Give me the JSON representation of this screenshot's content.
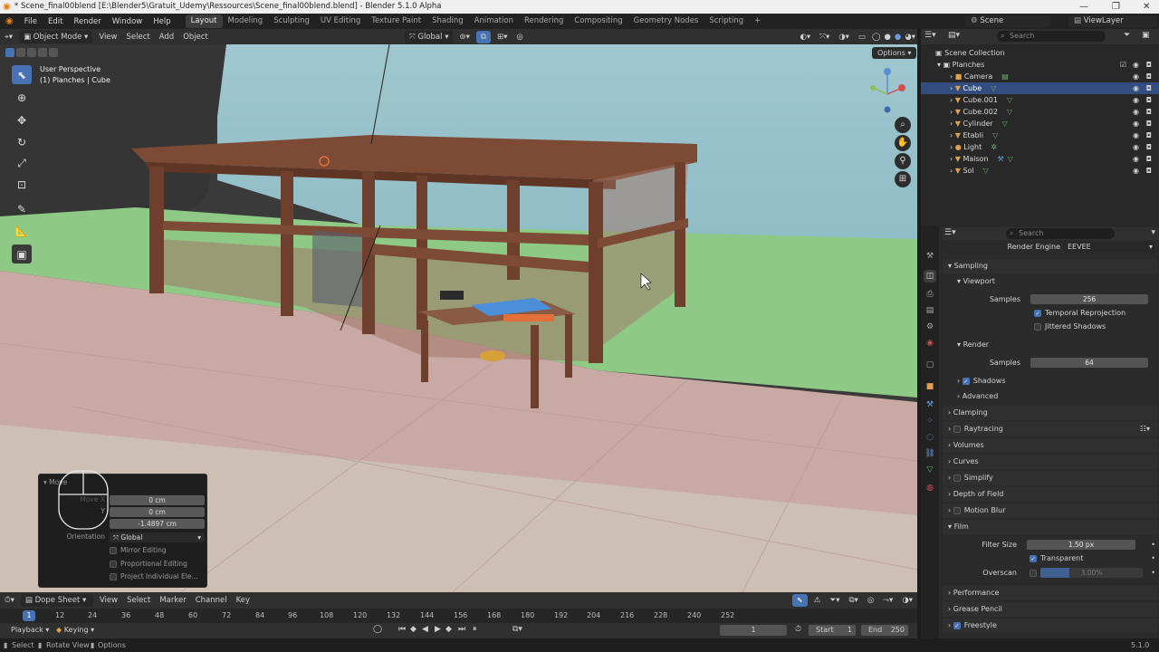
{
  "window": {
    "title": "* Scene_final00blend [E:\\Blender5\\Gratuit_Udemy\\Ressources\\Scene_final00blend.blend] - Blender 5.1.0 Alpha"
  },
  "menu": [
    "File",
    "Edit",
    "Render",
    "Window",
    "Help"
  ],
  "workspaces": [
    "Layout",
    "Modeling",
    "Sculpting",
    "UV Editing",
    "Texture Paint",
    "Shading",
    "Animation",
    "Rendering",
    "Compositing",
    "Geometry Nodes",
    "Scripting"
  ],
  "scene": {
    "name": "Scene",
    "view_layer": "ViewLayer"
  },
  "viewport": {
    "mode": "Object Mode",
    "menu": [
      "View",
      "Select",
      "Add",
      "Object"
    ],
    "transform_orientation": "Global",
    "options_label": "Options",
    "overlay_title": "User Perspective",
    "overlay_subtitle": "(1) Planches | Cube"
  },
  "move_panel": {
    "title": "Move",
    "move_x_label": "Move X",
    "y_label": "Y",
    "x_value": "0 cm",
    "y_value": "0 cm",
    "z_value": "-1.4897 cm",
    "orientation_label": "Orientation",
    "orientation_value": "Global",
    "mirror": "Mirror Editing",
    "proportional": "Proportional Editing",
    "project": "Project Individual Ele..."
  },
  "outliner": {
    "search_placeholder": "Search",
    "root": "Scene Collection",
    "collection": "Planches",
    "items": [
      "Camera",
      "Cube",
      "Cube.001",
      "Cube.002",
      "Cylinder",
      "Etabli",
      "Light",
      "Maison",
      "Sol"
    ]
  },
  "properties": {
    "search_placeholder": "Search",
    "render_engine_label": "Render Engine",
    "render_engine_value": "EEVEE",
    "sampling": "Sampling",
    "viewport": "Viewport",
    "samples_label": "Samples",
    "viewport_samples": "256",
    "temporal": "Temporal Reprojection",
    "jittered": "Jittered Shadows",
    "render": "Render",
    "render_samples": "64",
    "shadows": "Shadows",
    "advanced": "Advanced",
    "clamping": "Clamping",
    "raytracing": "Raytracing",
    "volumes": "Volumes",
    "curves": "Curves",
    "simplify": "Simplify",
    "dof": "Depth of Field",
    "motion_blur": "Motion Blur",
    "film": "Film",
    "filter_size_label": "Filter Size",
    "filter_size_value": "1.50 px",
    "transparent": "Transparent",
    "overscan_label": "Overscan",
    "overscan_value": "3.00%",
    "performance": "Performance",
    "grease_pencil": "Grease Pencil",
    "freestyle": "Freestyle"
  },
  "dopesheet": {
    "editor": "Dope Sheet",
    "menu": [
      "View",
      "Select",
      "Marker",
      "Channel",
      "Key"
    ],
    "frames": [
      "1",
      "12",
      "24",
      "36",
      "48",
      "60",
      "72",
      "84",
      "96",
      "108",
      "120",
      "132",
      "144",
      "156",
      "168",
      "180",
      "192",
      "204",
      "216",
      "228",
      "240",
      "252"
    ],
    "playback": "Playback",
    "keying": "Keying",
    "current_frame": "1",
    "start_label": "Start",
    "start_value": "1",
    "end_label": "End",
    "end_value": "250"
  },
  "status": {
    "select": "Select",
    "rotate": "Rotate View",
    "options": "Options",
    "version": "5.1.0"
  }
}
